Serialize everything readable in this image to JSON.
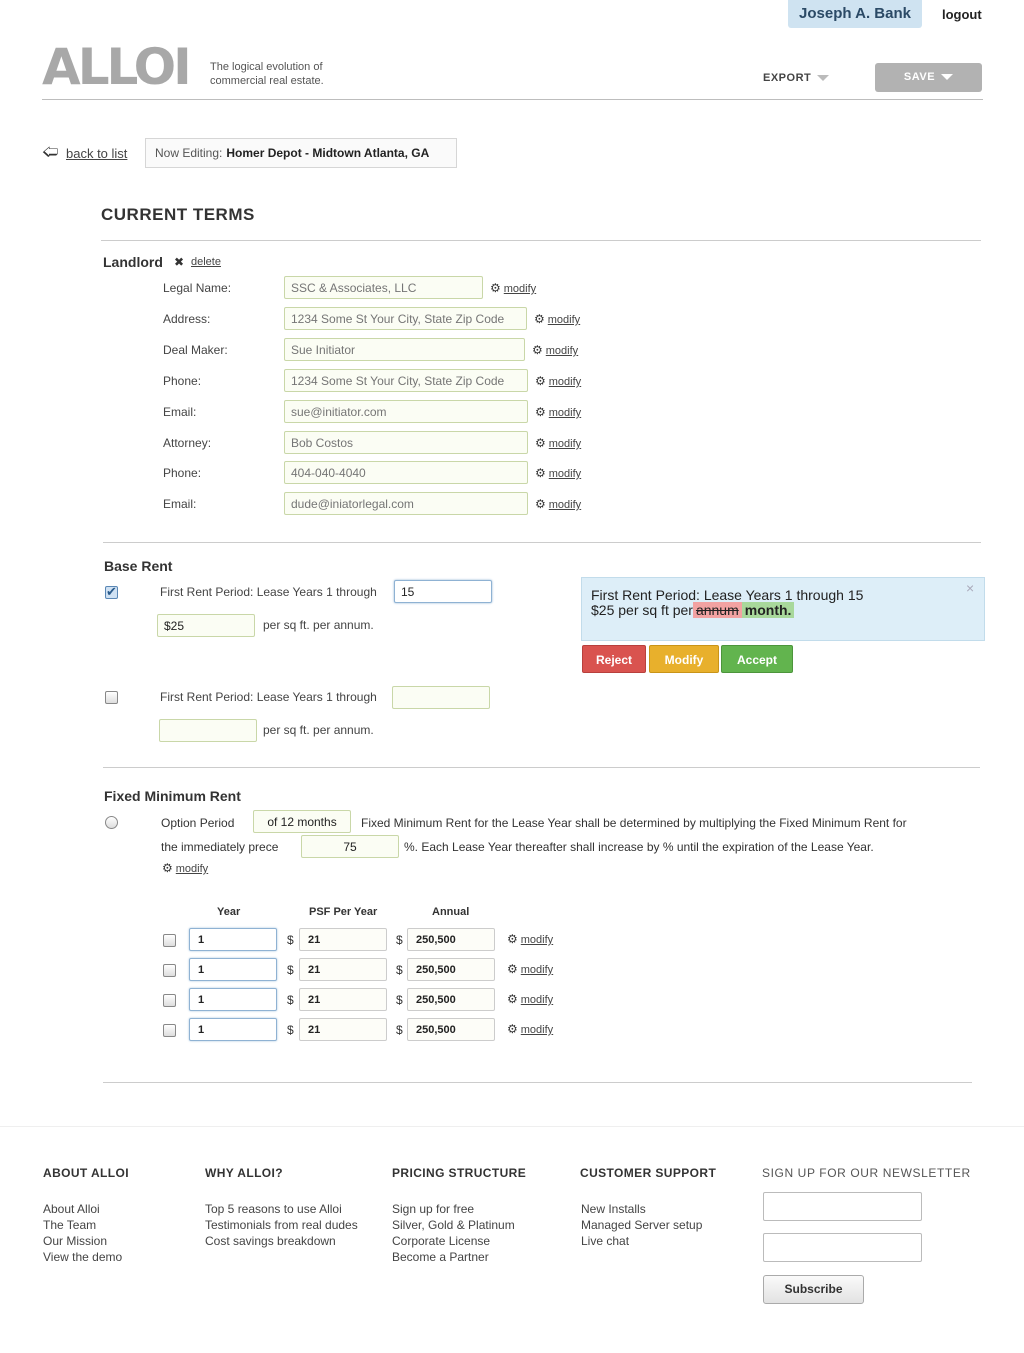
{
  "header": {
    "user_name": "Joseph A. Bank",
    "logout": "logout",
    "logo": "ALLOI",
    "tagline": "The logical evolution of commercial real estate.",
    "export": "EXPORT",
    "save": "SAVE"
  },
  "editbar": {
    "back": "back to list",
    "now_editing_label": "Now Editing:",
    "now_editing_value": "Homer Depot - Midtown Atlanta, GA"
  },
  "current_terms": {
    "title": "CURRENT TERMS",
    "landlord": {
      "title": "Landlord",
      "delete": "delete",
      "modify": "modify",
      "fields": [
        {
          "label": "Legal Name:",
          "placeholder": "SSC & Associates, LLC"
        },
        {
          "label": "Address:",
          "placeholder": "1234 Some St Your City, State Zip Code"
        },
        {
          "label": "Deal Maker:",
          "placeholder": "Sue Initiator"
        },
        {
          "label": "Phone:",
          "placeholder": "1234 Some St Your City, State Zip Code"
        },
        {
          "label": "Email:",
          "placeholder": "sue@initiator.com"
        },
        {
          "label": "Attorney:",
          "placeholder": "Bob Costos"
        },
        {
          "label": "Phone:",
          "placeholder": "404-040-4040"
        },
        {
          "label": "Email:",
          "placeholder": "dude@iniatorlegal.com"
        }
      ]
    }
  },
  "base_rent": {
    "title": "Base Rent",
    "period_label": "First Rent Period: Lease Years 1 through",
    "period_value": "15",
    "rent_value": "$25",
    "per_label": "per sq ft. per annum.",
    "period2_label": "First Rent Period: Lease Years 1 through",
    "per2_label": "per sq ft. per annum.",
    "notice": {
      "line1": "First Rent Period: Lease Years 1 through 15",
      "line2_prefix": "$25 per sq ft per",
      "deleted": "annum",
      "inserted": "month.",
      "close": "×"
    },
    "buttons": {
      "reject": "Reject",
      "modify": "Modify",
      "accept": "Accept"
    }
  },
  "fixed_min_rent": {
    "title": "Fixed Minimum Rent",
    "option_label": "Option Period",
    "option_value": "of 12 months",
    "sentence_a": "Fixed Minimum Rent for the  Lease Year shall be determined by multiplying the Fixed Minimum Rent for",
    "sentence_b": "the immediately prece",
    "pct_value": "75",
    "sentence_c": "%. Each Lease Year thereafter shall increase by % until the expiration of the  Lease Year.",
    "modify": "modify",
    "table": {
      "headers": [
        "Year",
        "PSF Per Year",
        "Annual"
      ],
      "currency": "$",
      "rows": [
        {
          "year": "1",
          "psf": "21",
          "annual": "250,500"
        },
        {
          "year": "1",
          "psf": "21",
          "annual": "250,500"
        },
        {
          "year": "1",
          "psf": "21",
          "annual": "250,500"
        },
        {
          "year": "1",
          "psf": "21",
          "annual": "250,500"
        }
      ]
    }
  },
  "footer": {
    "about": {
      "title": "ABOUT ALLOI",
      "links": [
        "About Alloi",
        "The Team",
        "Our Mission",
        "View the demo"
      ]
    },
    "why": {
      "title": "WHY ALLOI?",
      "links": [
        "Top 5 reasons to use Alloi",
        "Testimonials from real dudes",
        "Cost savings breakdown"
      ]
    },
    "pricing": {
      "title": "PRICING STRUCTURE",
      "links": [
        "Sign up for free",
        "Silver, Gold & Platinum",
        "Corporate License",
        "Become a Partner"
      ]
    },
    "support": {
      "title": "CUSTOMER SUPPORT",
      "links": [
        "New Installs",
        "Managed Server setup",
        "Live chat"
      ]
    },
    "newsletter": {
      "title": "SIGN UP FOR OUR NEWSLETTER",
      "subscribe": "Subscribe"
    }
  }
}
